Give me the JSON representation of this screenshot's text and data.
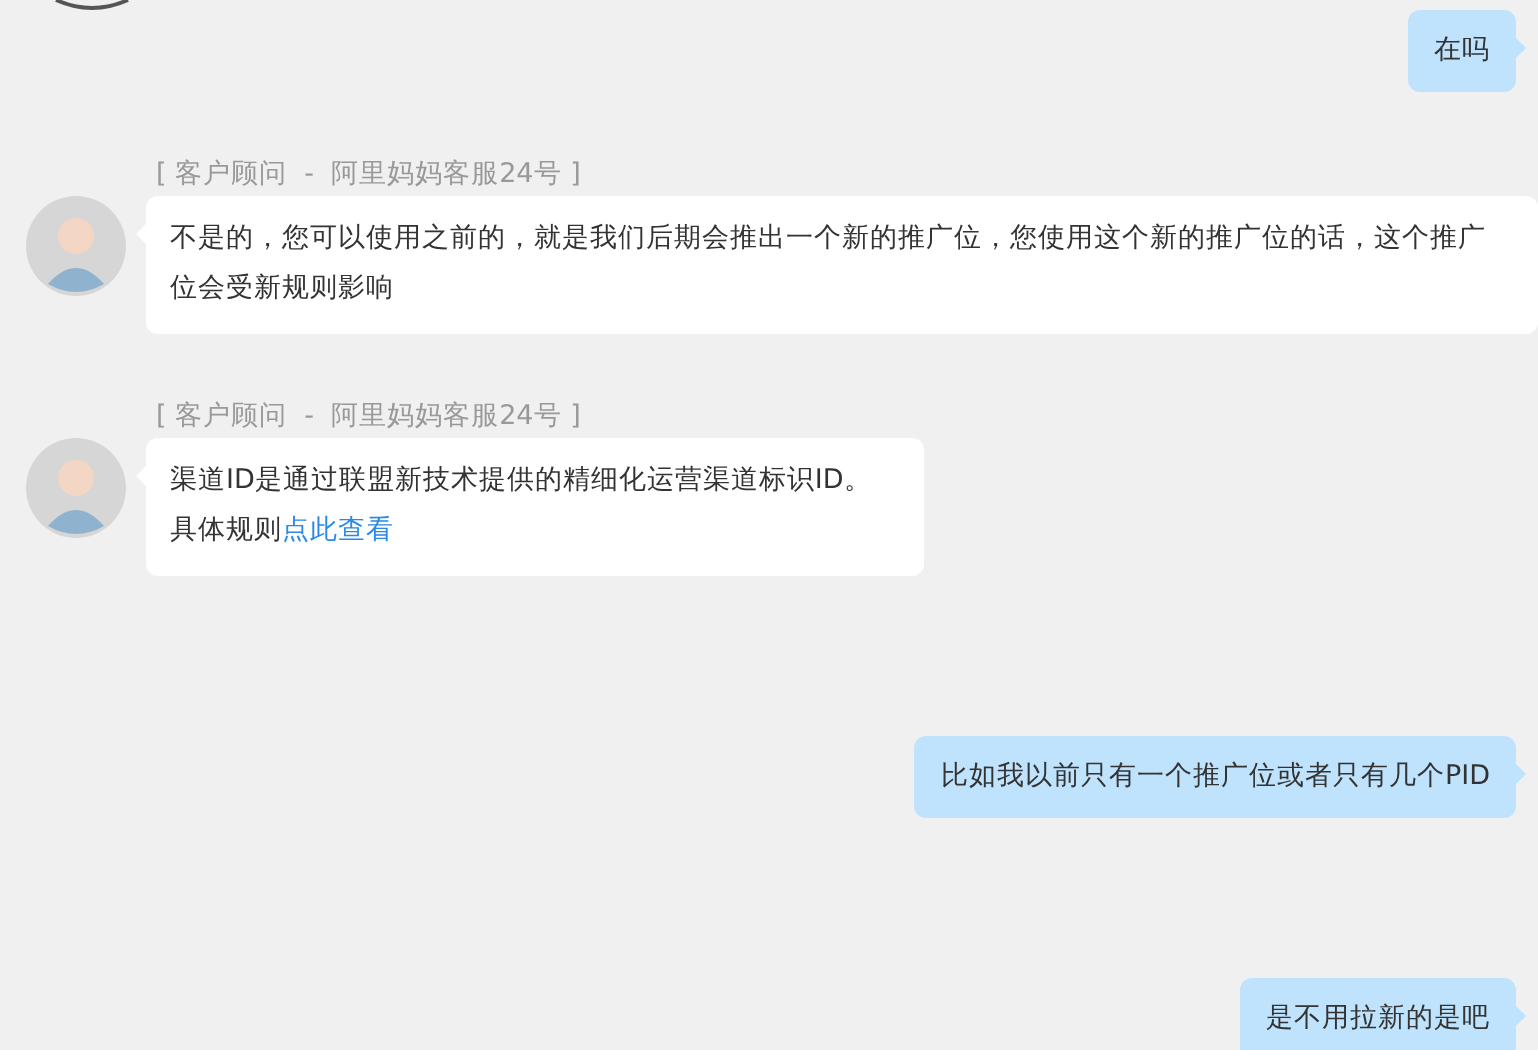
{
  "messages": [
    {
      "kind": "outgoing",
      "lines": [
        {
          "text": "在吗"
        }
      ]
    },
    {
      "kind": "incoming",
      "sender": "[ 客户顾问  -  阿里妈妈客服24号 ]",
      "lines": [
        {
          "text": "不是的，您可以使用之前的，就是我们后期会推出一个新的推广位，您使用这个新的推广位的话，这个推广位会受新规则影响"
        }
      ]
    },
    {
      "kind": "incoming",
      "sender": "[ 客户顾问  -  阿里妈妈客服24号 ]",
      "lines": [
        {
          "text": "渠道ID是通过联盟新技术提供的精细化运营渠道标识ID。"
        },
        {
          "text": "具体规则",
          "link": "点此查看"
        }
      ]
    },
    {
      "kind": "outgoing",
      "lines": [
        {
          "text": "比如我以前只有一个推广位或者只有几个PID"
        }
      ]
    },
    {
      "kind": "outgoing",
      "lines": [
        {
          "text": "是不用拉新的是吧"
        }
      ]
    }
  ]
}
